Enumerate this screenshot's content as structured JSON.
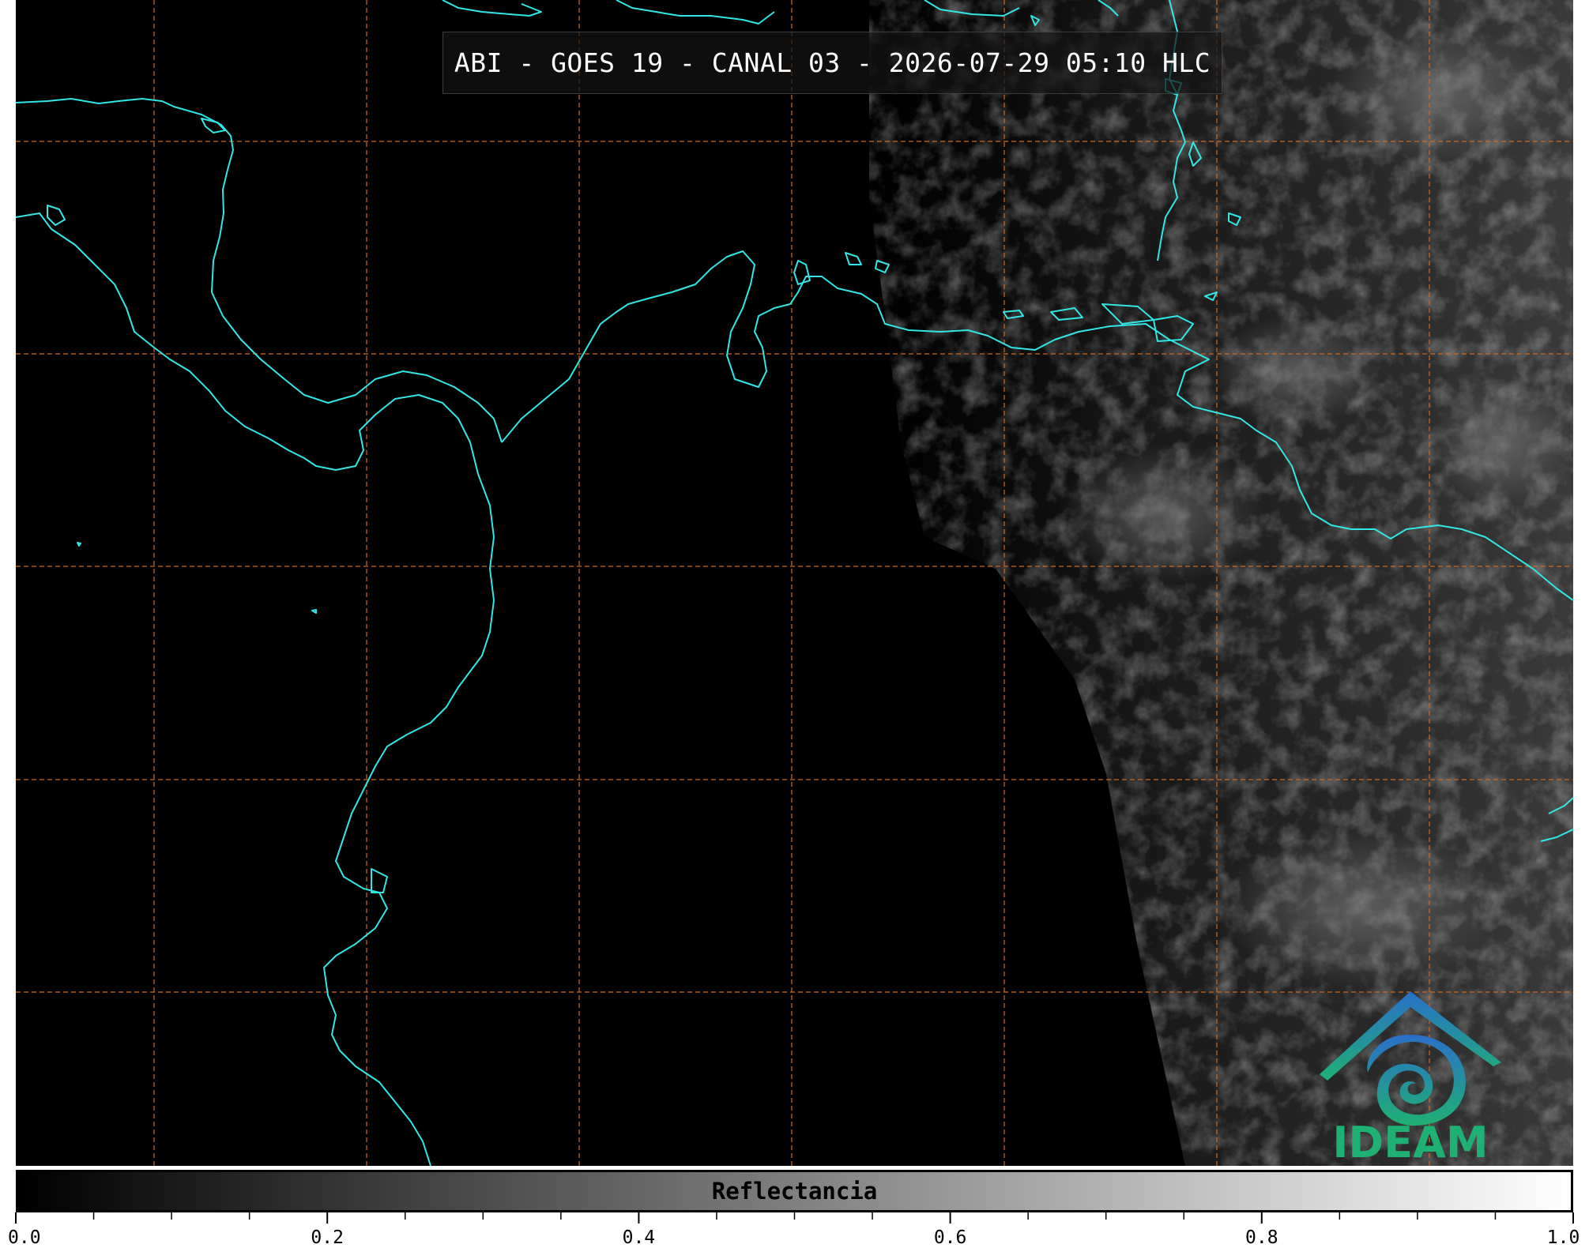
{
  "title": "ABI - GOES 19 - CANAL 03 - 2026-07-29 05:10 HLC",
  "colorbar": {
    "label": "Reflectancia",
    "min": 0.0,
    "max": 1.0,
    "tick_labels": [
      "0.0",
      "0.2",
      "0.4",
      "0.6",
      "0.8",
      "1.0"
    ]
  },
  "logo": {
    "text": "IDEAM"
  },
  "colors": {
    "coastline": "#33e6e6",
    "gridline": "#d2691e",
    "logo_blue": "#2a7fc0",
    "logo_green": "#1fb074"
  },
  "icons": {
    "logo": "ideam-logo-icon"
  }
}
